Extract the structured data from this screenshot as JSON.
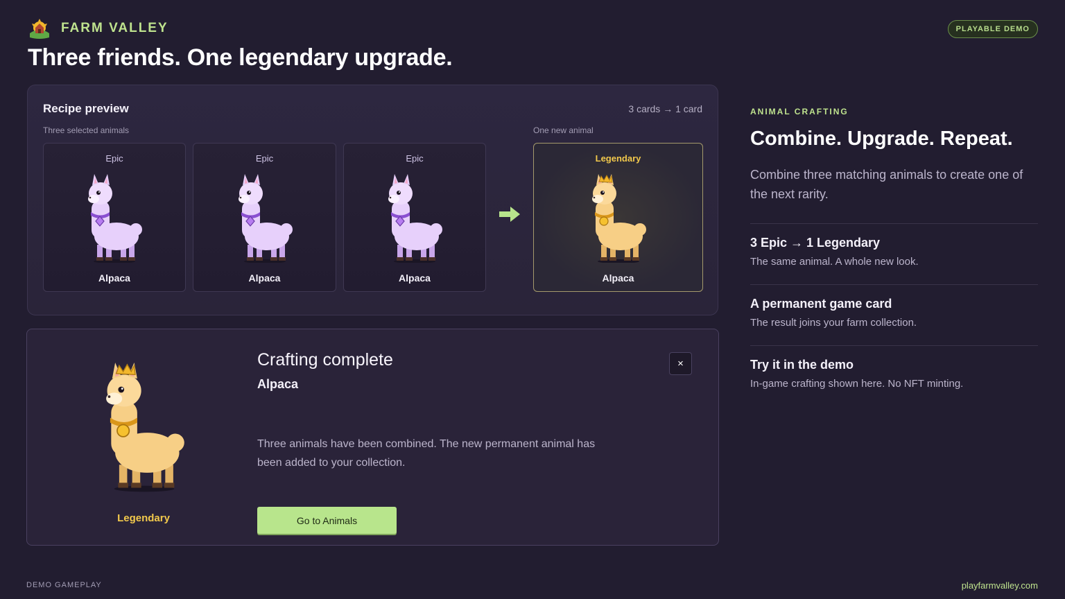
{
  "brand": {
    "name": "FARM VALLEY",
    "logo_icon": "farm-valley-logo-icon"
  },
  "badge": "PLAYABLE DEMO",
  "headline": "Three friends. One legendary upgrade.",
  "recipe": {
    "title": "Recipe preview",
    "count": "3 cards → 1 card",
    "inputs_label": "Three selected animals",
    "output_label": "One new animal",
    "inputs": [
      {
        "rarity": "Epic",
        "name": "Alpaca"
      },
      {
        "rarity": "Epic",
        "name": "Alpaca"
      },
      {
        "rarity": "Epic",
        "name": "Alpaca"
      }
    ],
    "output": {
      "rarity": "Legendary",
      "name": "Alpaca"
    },
    "arrow_icon": "arrow-right-icon"
  },
  "complete": {
    "title": "Crafting complete",
    "animal": "Alpaca",
    "rarity": "Legendary",
    "description": "Three animals have been combined. The new permanent animal has been added to your collection.",
    "button": "Go to Animals",
    "close": "×"
  },
  "side": {
    "eyebrow": "ANIMAL CRAFTING",
    "title": "Combine. Upgrade. Repeat.",
    "description": "Combine three matching animals to create one of the next rarity.",
    "features": [
      {
        "title": "3 Epic → 1 Legendary",
        "desc": "The same animal. A whole new look."
      },
      {
        "title": "A permanent game card",
        "desc": "The result joins your farm collection."
      },
      {
        "title": "Try it in the demo",
        "desc": "In-game crafting shown here. No NFT minting."
      }
    ]
  },
  "footer": {
    "left": "DEMO GAMEPLAY",
    "right": "playfarmvalley.com"
  },
  "colors": {
    "accent": "#bfe38e",
    "legendary": "#f2c94c",
    "epic": "#d6b3f5",
    "background": "#221d30"
  }
}
